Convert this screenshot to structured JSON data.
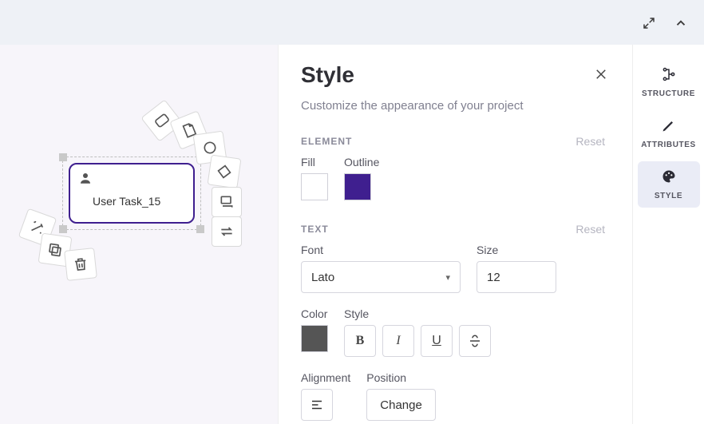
{
  "canvas": {
    "node_label": "User Task_15"
  },
  "panel": {
    "title": "Style",
    "subtitle": "Customize the appearance of your project",
    "sections": {
      "element": {
        "heading": "ELEMENT",
        "reset": "Reset",
        "fill_label": "Fill",
        "outline_label": "Outline",
        "fill_color": "#ffffff",
        "outline_color": "#3f1f8f"
      },
      "text": {
        "heading": "TEXT",
        "reset": "Reset",
        "font_label": "Font",
        "font_value": "Lato",
        "size_label": "Size",
        "size_value": "12",
        "color_label": "Color",
        "style_label": "Style",
        "bold_glyph": "B",
        "italic_glyph": "I",
        "underline_glyph": "U",
        "alignment_label": "Alignment",
        "position_label": "Position",
        "position_button": "Change"
      }
    }
  },
  "rail": {
    "structure": "STRUCTURE",
    "attributes": "ATTRIBUTES",
    "style": "STYLE"
  }
}
